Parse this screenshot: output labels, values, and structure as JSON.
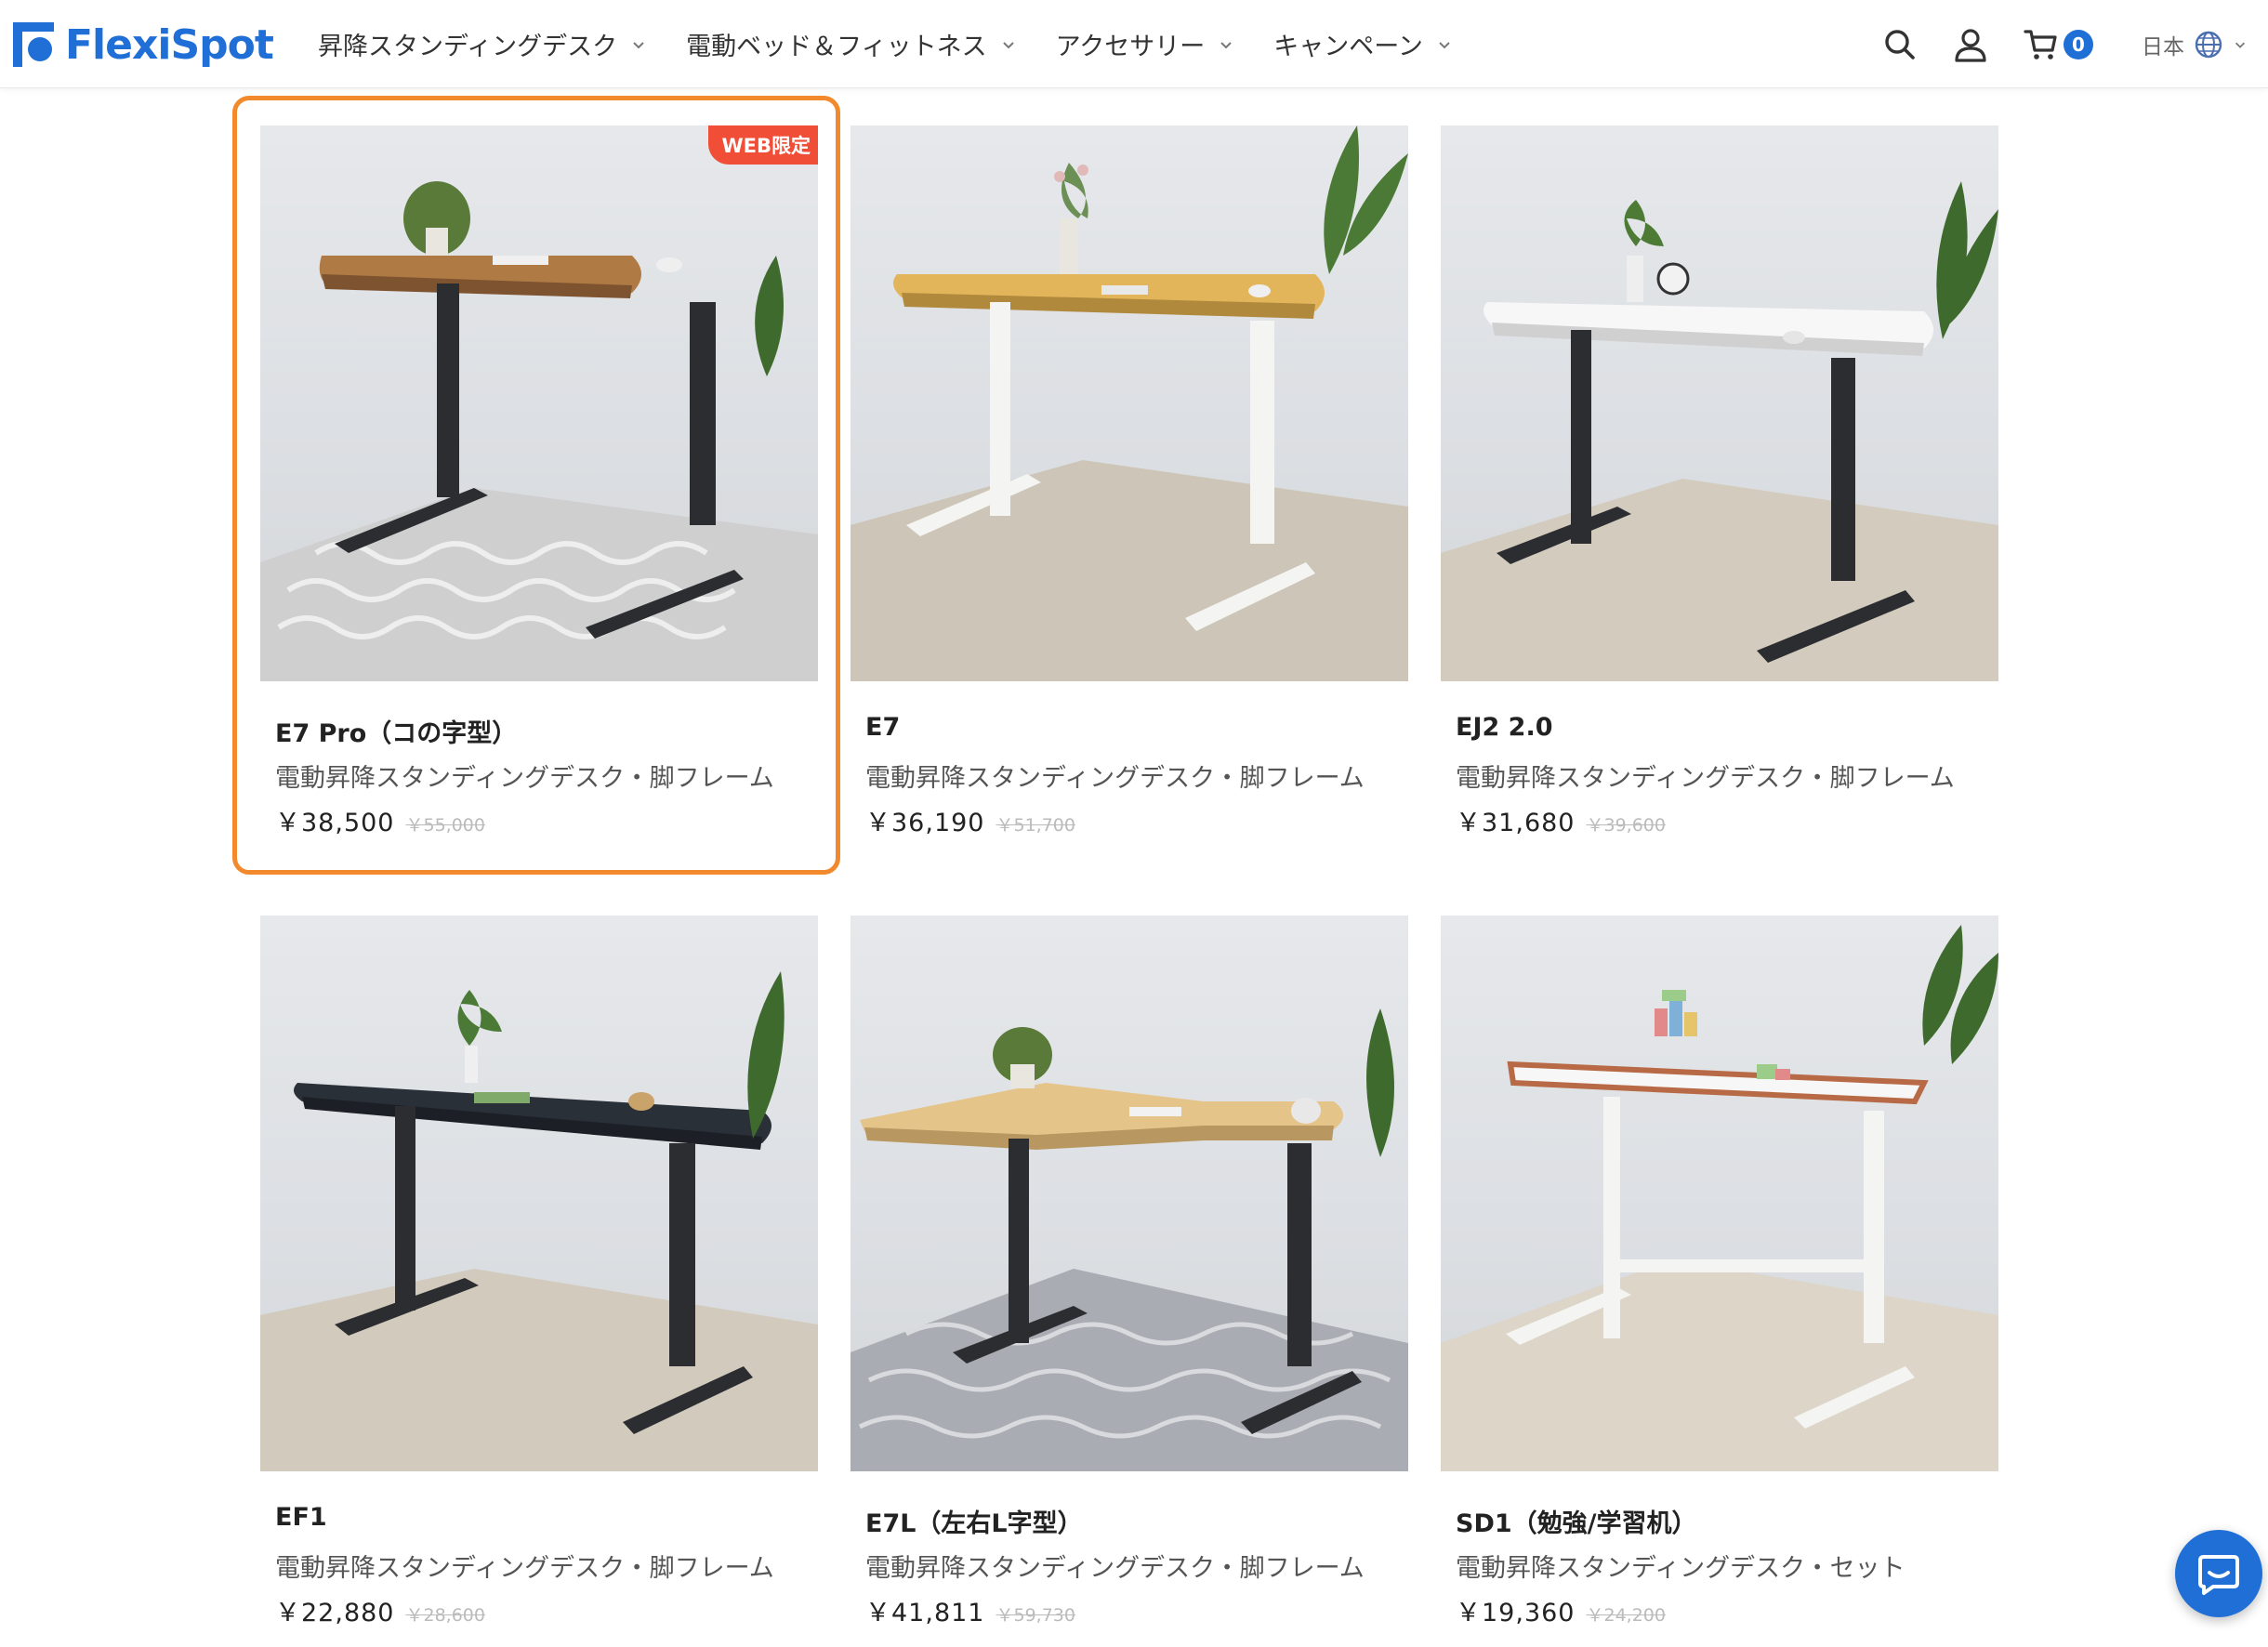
{
  "brand": {
    "name": "FlexiSpot",
    "color": "#1f6fd6"
  },
  "nav": {
    "items": [
      {
        "label": "昇降スタンディングデスク"
      },
      {
        "label": "電動ベッド＆フィットネス"
      },
      {
        "label": "アクセサリー"
      },
      {
        "label": "キャンペーン"
      }
    ]
  },
  "header_icons": {
    "search": "search-icon",
    "account": "user-icon",
    "cart": "cart-icon",
    "cart_count": "0",
    "language": "日本",
    "globe": "globe-icon"
  },
  "products": [
    {
      "name": "E7 Pro（コの字型）",
      "subtitle": "電動昇降スタンディングデスク・脚フレーム",
      "price": "￥38,500",
      "original_price": "￥55,000",
      "badge": "WEB限定",
      "top_color": "#b07a45",
      "leg_color": "#2b2d31",
      "rug": "pattern-light"
    },
    {
      "name": "E7",
      "subtitle": "電動昇降スタンディングデスク・脚フレーム",
      "price": "￥36,190",
      "original_price": "￥51,700",
      "top_color": "#e2b55a",
      "leg_color": "#f4f4f2",
      "rug": "beige"
    },
    {
      "name": "EJ2 2.0",
      "subtitle": "電動昇降スタンディングデスク・脚フレーム",
      "price": "￥31,680",
      "original_price": "￥39,600",
      "top_color": "#f7f7f7",
      "leg_color": "#2b2d31",
      "rug": "beige"
    },
    {
      "name": "EF1",
      "subtitle": "電動昇降スタンディングデスク・脚フレーム",
      "price": "￥22,880",
      "original_price": "￥28,600",
      "top_color": "#2a3038",
      "leg_color": "#2b2d31",
      "rug": "beige"
    },
    {
      "name": "E7L（左右L字型）",
      "subtitle": "電動昇降スタンディングデスク・脚フレーム",
      "price": "￥41,811",
      "original_price": "￥59,730",
      "top_color": "#e5c48a",
      "leg_color": "#2b2d31",
      "rug": "grey-wave"
    },
    {
      "name": "SD1（勉強/学習机）",
      "subtitle": "電動昇降スタンディングデスク・セット",
      "price": "￥19,360",
      "original_price": "￥24,200",
      "top_color": "#f7f7f7",
      "leg_color": "#f4f4f2",
      "rug": "beige"
    }
  ],
  "colors": {
    "highlight": "#f28a2d",
    "badge": "#f04e37"
  }
}
